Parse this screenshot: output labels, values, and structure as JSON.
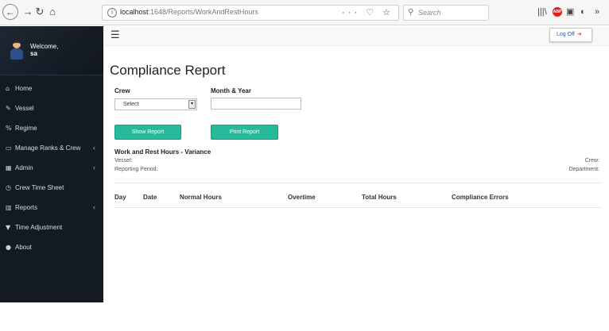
{
  "browser": {
    "back_glyph": "←",
    "forward_glyph": "→",
    "reload_glyph": "↻",
    "home_glyph": "⌂",
    "url_host": "localhost",
    "url_path": ":1648/Reports/WorkAndRestHours",
    "url_actions": "··· ♡ ☆",
    "search_placeholder": "Search"
  },
  "sidebar": {
    "welcome": "Welcome,",
    "username": "sa",
    "items": [
      {
        "label": "Home",
        "icon": "home-icon",
        "glyph": "⌂"
      },
      {
        "label": "Vessel",
        "icon": "edit-icon",
        "glyph": "✎"
      },
      {
        "label": "Regime",
        "icon": "link-icon",
        "glyph": "%"
      },
      {
        "label": "Manage Ranks & Crew",
        "icon": "desktop-icon",
        "glyph": "▭",
        "caret": "‹"
      },
      {
        "label": "Admin",
        "icon": "table-icon",
        "glyph": "▦",
        "caret": "‹"
      },
      {
        "label": "Crew Time Sheet",
        "icon": "clock-icon",
        "glyph": "◷"
      },
      {
        "label": "Reports",
        "icon": "bar-chart-icon",
        "glyph": "▥",
        "caret": "‹"
      },
      {
        "label": "Time Adjustment",
        "icon": "filter-icon",
        "glyph": "▼"
      },
      {
        "label": "About",
        "icon": "user-icon",
        "glyph": "●"
      }
    ]
  },
  "topbar": {
    "menu_glyph": "☰",
    "logoff_label": "Log Off",
    "logoff_glyph": "➜"
  },
  "main": {
    "title": "Compliance Report",
    "crew_label": "Crew",
    "crew_selected": "Select",
    "crew_arrow": "▾",
    "month_year_label": "Month & Year",
    "month_year_value": "",
    "show_report": "Show Report",
    "print_report": "Print Report",
    "section_title": "Work and Rest Hours - Variance",
    "vessel_label": "Vessel:",
    "reporting_period_label": "Reporting Period:",
    "crew_right_label": "Crew:",
    "department_label": "Department:",
    "table_headers": [
      "Day",
      "Date",
      "Normal Hours",
      "Overtime",
      "Total Hours",
      "Compliance Errors"
    ]
  },
  "colors": {
    "sidebar_bg": "#141a24",
    "accent_button": "#26b99a",
    "logoff_text": "#2a5d9f"
  }
}
